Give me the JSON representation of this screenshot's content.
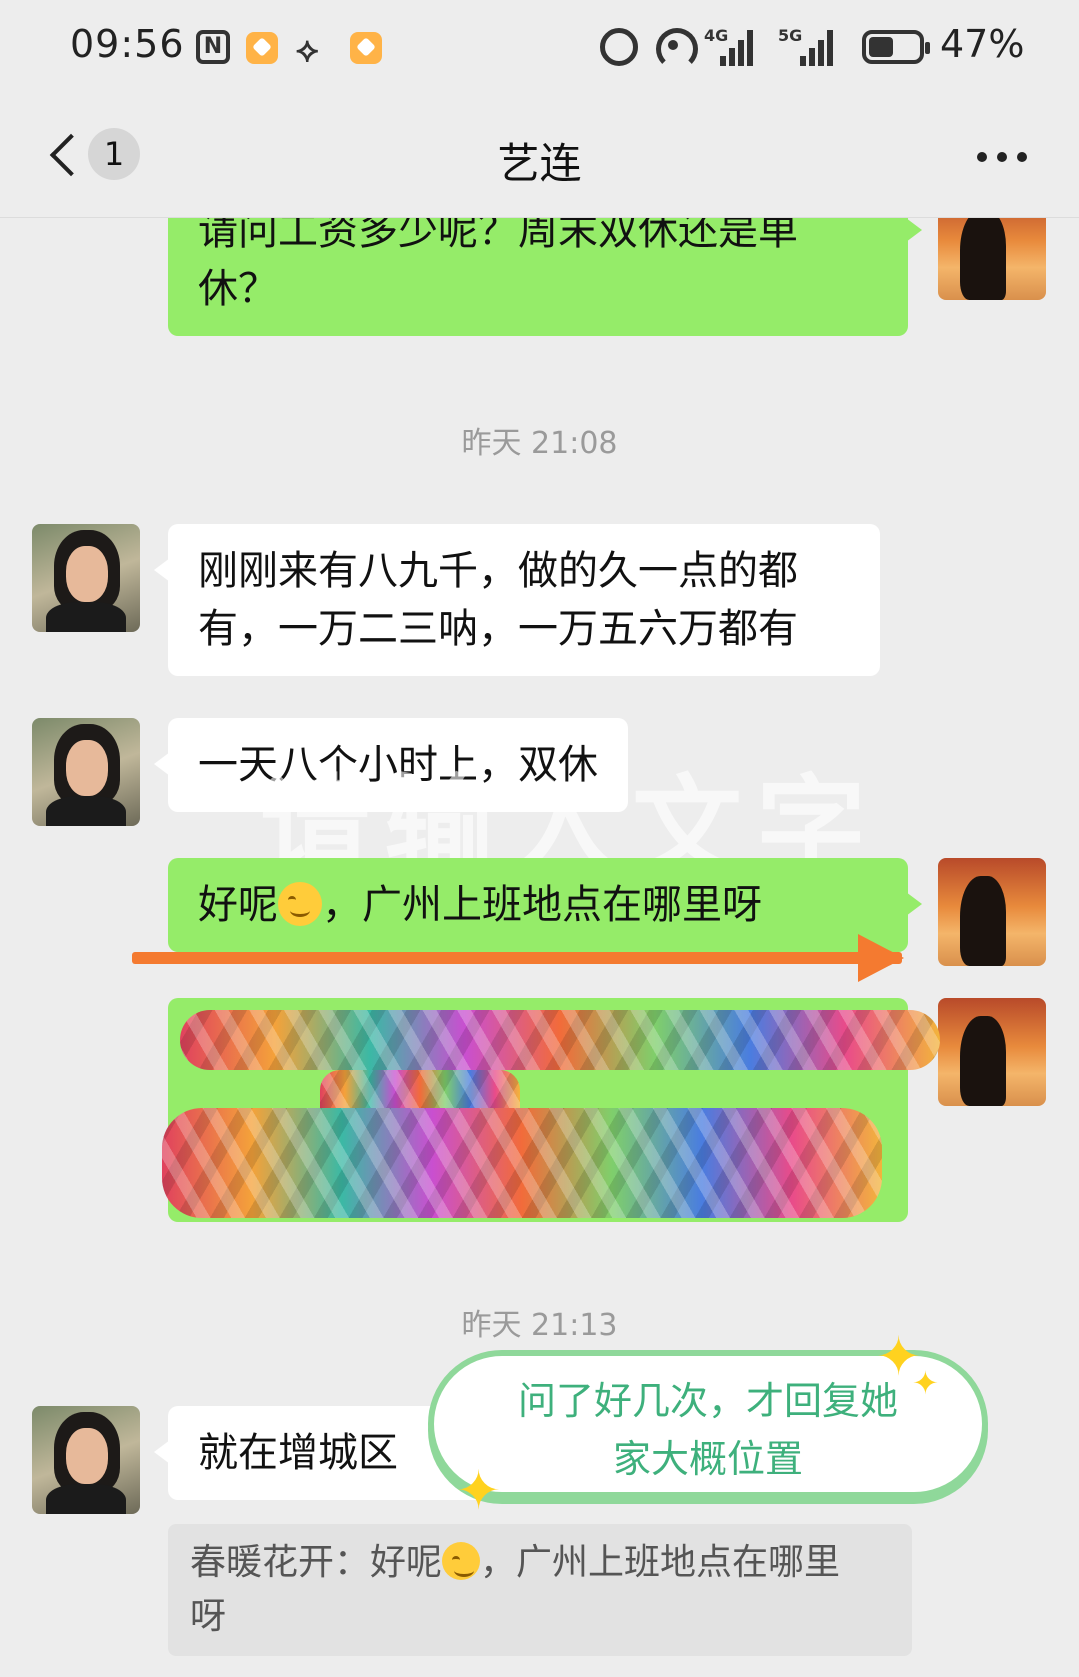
{
  "status_bar": {
    "time": "09:56",
    "net1": "4G",
    "net2": "5G",
    "battery": "47%"
  },
  "header": {
    "unread_count": "1",
    "title": "艺连"
  },
  "messages": {
    "m1_line1": "请问工资多少呢？周末双休还是单",
    "m1_line2": "休？",
    "ts1": "昨天 21:08",
    "m2_line1": "刚刚来有八九千，做的久一点的都",
    "m2_line2": "有，一万二三呐，一万五六万都有",
    "m3": "一天八个小时上，双休",
    "m4_pre": "好呢",
    "m4_post": "，广州上班地点在哪里呀",
    "ts2": "昨天 21:13",
    "m5": "就在增城区",
    "quote_pre": "春暖花开：好呢",
    "quote_post": "，广州上班地点在哪里",
    "quote_line2": "呀"
  },
  "overlay": {
    "watermark": "请输入文字",
    "annotation_line1": "问了好几次，才回复她",
    "annotation_line2": "家大概位置"
  },
  "colors": {
    "self_bubble": "#95ec69",
    "other_bubble": "#ffffff",
    "arrow": "#f47a30",
    "annotation_text": "#3eb07c"
  }
}
